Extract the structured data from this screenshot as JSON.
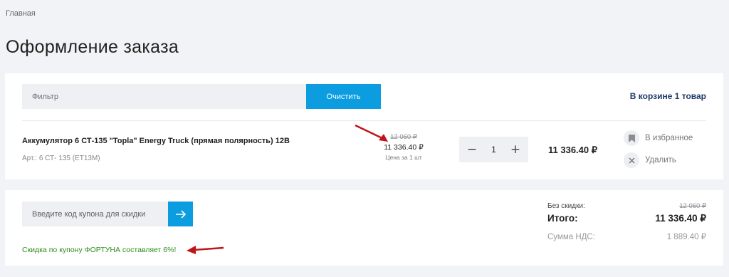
{
  "breadcrumb": {
    "home": "Главная"
  },
  "page": {
    "title": "Оформление заказа"
  },
  "filter": {
    "placeholder": "Фильтр",
    "clear_label": "Очистить",
    "cart_count": "В корзине 1 товар"
  },
  "product": {
    "name": "Аккумулятор 6 СТ-135 \"Topla\" Energy Truck (прямая полярность) 12В",
    "article": "Арт.: 6 СТ- 135 (ЕТ13М)",
    "old_price": "12 060 ₽",
    "price": "11 336.40 ₽",
    "unit_label": "Цена за 1 шт",
    "quantity": "1",
    "minus": "−",
    "plus": "+",
    "line_total": "11 336.40 ₽",
    "favorite_label": "В избранное",
    "delete_label": "Удалить"
  },
  "coupon": {
    "placeholder": "Введите код купона для скидки",
    "submit_icon": "arrow-right-icon",
    "message": "Скидка по купону ФОРТУНА составляет 6%!"
  },
  "summary": {
    "no_discount_label": "Без скидки:",
    "no_discount_value": "12 060 ₽",
    "total_label": "Итого:",
    "total_value": "11 336.40 ₽",
    "vat_label": "Сумма НДС:",
    "vat_value": "1 889.40 ₽"
  },
  "colors": {
    "accent": "#0b9de0",
    "success": "#2f8c1e",
    "annotation": "#c0141a"
  }
}
